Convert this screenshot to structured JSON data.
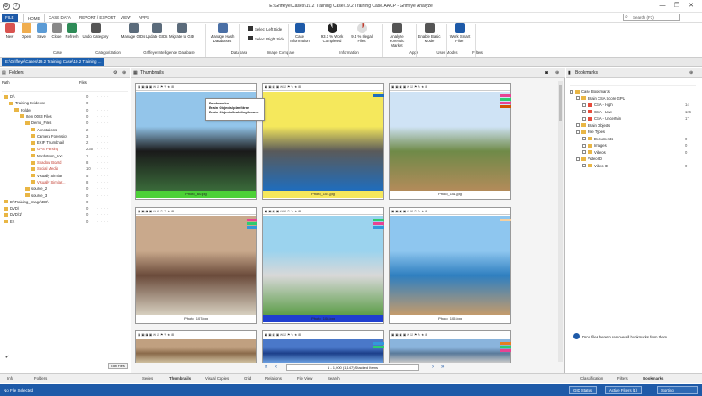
{
  "window": {
    "title": "E:\\Griffeye\\Cases\\19.2 Training Case\\19.2 Training Case.AACP - Griffeye Analyze",
    "quick_access": [
      "⚙",
      "?"
    ],
    "controls": [
      "—",
      "❐",
      "✕"
    ]
  },
  "tabs": [
    "FILE",
    "HOME",
    "CASE DATA",
    "REPORT / EXPORT",
    "VIEW",
    "APPS"
  ],
  "search": {
    "placeholder": "Search (F3)"
  },
  "ribbon": {
    "buttons": [
      {
        "label": "New",
        "color": "#d9534f"
      },
      {
        "label": "Open",
        "color": "#f0ad4e"
      },
      {
        "label": "Save",
        "color": "#5b9bd5"
      },
      {
        "label": "Close",
        "color": "#888888"
      },
      {
        "label": "Refresh",
        "color": "#2e8b57"
      },
      {
        "label": "Undo Category",
        "color": "#555555"
      },
      {
        "label": "Manage GIDs",
        "color": "#5b6b7b"
      },
      {
        "label": "Update GIDs",
        "color": "#5b6b7b"
      },
      {
        "label": "Migrate to GID",
        "color": "#5b6b7b"
      },
      {
        "label": "Manage Hash Databases",
        "color": "#4a6fa5"
      },
      {
        "label": "Select Left Side",
        "color": "#333333"
      },
      {
        "label": "Select Right Side",
        "color": "#333333"
      },
      {
        "label": "Case Information",
        "color": "#1e5aa8"
      },
      {
        "label": "93.1 % Work Completed",
        "color": "#222222"
      },
      {
        "label": "9.4 % Illegal Files",
        "color": "#c0392b"
      },
      {
        "label": "Analyze Forensic Market",
        "color": "#555555"
      },
      {
        "label": "Enable Basic Mode",
        "color": "#555555"
      },
      {
        "label": "Work Smart Filter",
        "color": "#1e5aa8"
      }
    ],
    "groups": [
      "Case",
      "Categorization",
      "Griffeye Intelligence Database",
      "Database",
      "Image Compare",
      "Information",
      "Apps",
      "User Modes",
      "Filters"
    ]
  },
  "path_tab": "E:\\Griffeye\\Cases\\19.2 Training Case\\19.2 Training ...",
  "folders": {
    "title": "Folders",
    "col_path": "Path",
    "col_files": "Files",
    "rows": [
      {
        "name": "D:\\",
        "files": "0",
        "level": 0,
        "color": "#222"
      },
      {
        "name": "Training Evidence",
        "files": "0",
        "level": 1,
        "color": "#222"
      },
      {
        "name": "Folder",
        "files": "0",
        "level": 2,
        "color": "#222"
      },
      {
        "name": "Item 0003 Files",
        "files": "0",
        "level": 3,
        "color": "#222"
      },
      {
        "name": "Demo_Files",
        "files": "0",
        "level": 4,
        "color": "#222"
      },
      {
        "name": "Annotations",
        "files": "2",
        "level": 5,
        "color": "#222"
      },
      {
        "name": "Camera Forensics",
        "files": "3",
        "level": 5,
        "color": "#222"
      },
      {
        "name": "EXIF Thumbnail",
        "files": "2",
        "level": 5,
        "color": "#222"
      },
      {
        "name": "GPS Parsing",
        "files": "235",
        "level": 5,
        "color": "#c0392b"
      },
      {
        "name": "Nordstrom_Loc...",
        "files": "1",
        "level": 5,
        "color": "#222"
      },
      {
        "name": "Shadow Board",
        "files": "8",
        "level": 5,
        "color": "#c0392b"
      },
      {
        "name": "Social Media",
        "files": "10",
        "level": 5,
        "color": "#c0392b"
      },
      {
        "name": "Visually Similar",
        "files": "5",
        "level": 5,
        "color": "#222"
      },
      {
        "name": "Visually Similar...",
        "files": "8",
        "level": 5,
        "color": "#c0392b"
      },
      {
        "name": "source_2",
        "files": "0",
        "level": 4,
        "color": "#222"
      },
      {
        "name": "source_3",
        "files": "0",
        "level": 4,
        "color": "#222"
      },
      {
        "name": "D:\\Training_Image\\ED\\",
        "files": "0",
        "level": 0,
        "color": "#222"
      },
      {
        "name": "DVD\\",
        "files": "0",
        "level": 0,
        "color": "#222"
      },
      {
        "name": "DVD\\1\\",
        "files": "0",
        "level": 0,
        "color": "#222"
      },
      {
        "name": "E:\\",
        "files": "0",
        "level": 0,
        "color": "#222"
      }
    ],
    "edit_button": "Edit Files",
    "bottom_tabs": [
      "Info",
      "Folders"
    ]
  },
  "thumbnails": {
    "title": "Thumbnails",
    "toolbar_text": "▣ ▣ ▣ ▣ ✉ ☑ ⚑ ✎ ★ ⊞",
    "items": [
      {
        "caption": "Photo_60.jpg",
        "bar": "#4cd137",
        "pic": [
          "#93c5ea",
          "#1a1a1a",
          "#3a6b3a"
        ],
        "tags": []
      },
      {
        "caption": "Photo_104.jpg",
        "bar": "#f5e85c",
        "pic": [
          "#f5e85c",
          "#5a5a5a",
          "#1f6dbd"
        ],
        "tags": [
          "#1f6dbd"
        ]
      },
      {
        "caption": "Photo_101.jpg",
        "bar": "#ffffff",
        "pic": [
          "#cfe3f5",
          "#6f8a48",
          "#b38b5a"
        ],
        "tags": [
          "#e84393",
          "#2ecc71",
          "#e84393",
          "#d35400"
        ]
      },
      {
        "caption": "Photo_107.jpg",
        "bar": "#ffffff",
        "pic": [
          "#c9a98c",
          "#6b4b3b",
          "#d7d0c0"
        ],
        "tags": [
          "#e84393",
          "#2ecc71",
          "#3498db"
        ]
      },
      {
        "caption": "Photo_108.jpg",
        "bar": "#1f3fd0",
        "pic": [
          "#9bd3ee",
          "#d8d8d8",
          "#5d9e4a"
        ],
        "tags": [
          "#2ecc71",
          "#e84393",
          "#3498db"
        ]
      },
      {
        "caption": "Photo_105.jpg",
        "bar": "#ffffff",
        "pic": [
          "#8ec6ef",
          "#2f7fc0",
          "#c49b6c"
        ],
        "tags": [
          "#f5d0a0"
        ]
      },
      {
        "caption": "",
        "bar": "#ffffff",
        "pic": [
          "#c0a080",
          "#8a6a4a",
          "#d0c0a0"
        ],
        "tags": []
      },
      {
        "caption": "",
        "bar": "#ffffff",
        "pic": [
          "#4a78c9",
          "#1c3f8a",
          "#6b9fe0"
        ],
        "tags": [
          "#3498db",
          "#2ecc71"
        ]
      },
      {
        "caption": "",
        "bar": "#ffffff",
        "pic": [
          "#8ab4dc",
          "#5a7a9a",
          "#c9c9c9"
        ],
        "tags": [
          "#e67e22",
          "#2ecc71",
          "#e84393"
        ]
      }
    ],
    "tooltip": {
      "title": "Bookmarks",
      "lines": [
        "Brain Objects\\plant\\tree",
        "Brain Objects\\building\\house"
      ]
    },
    "pager": {
      "text": "1 - 1,000 (1,147) Stacked Items",
      "prev": "«",
      "prev1": "‹",
      "next1": "›",
      "next": "»"
    },
    "bottom_tabs": [
      "Series",
      "Thumbnails",
      "Visual Copies",
      "Grid",
      "Relations",
      "File View",
      "Search"
    ]
  },
  "bookmarks": {
    "title": "Bookmarks",
    "rows": [
      {
        "name": "Case Bookmarks",
        "count": "",
        "level": 0,
        "swatch": ""
      },
      {
        "name": "Brain CSA Score GPU",
        "count": "",
        "level": 1,
        "swatch": ""
      },
      {
        "name": "CSA - High",
        "count": "14",
        "level": 2,
        "swatch": "#e74c3c"
      },
      {
        "name": "CSA - Low",
        "count": "126",
        "level": 2,
        "swatch": "#e74c3c"
      },
      {
        "name": "CSA - Uncertain",
        "count": "17",
        "level": 2,
        "swatch": "#e74c3c"
      },
      {
        "name": "Brain Objects",
        "count": "",
        "level": 1,
        "swatch": ""
      },
      {
        "name": "File Types",
        "count": "",
        "level": 1,
        "swatch": ""
      },
      {
        "name": "Documents",
        "count": "0",
        "level": 2,
        "swatch": ""
      },
      {
        "name": "Images",
        "count": "0",
        "level": 2,
        "swatch": ""
      },
      {
        "name": "Videos",
        "count": "0",
        "level": 2,
        "swatch": ""
      },
      {
        "name": "Video ID",
        "count": "",
        "level": 1,
        "swatch": ""
      },
      {
        "name": "Video ID",
        "count": "0",
        "level": 2,
        "swatch": ""
      }
    ],
    "drop_hint": "Drop files here to remove all bookmarks from them",
    "bottom_tabs": [
      "Classification",
      "Filters",
      "Bookmarks"
    ]
  },
  "status": {
    "left": "No File Selected",
    "gid": "GID Status",
    "filters": "Active Filters (1)",
    "sorting": "Sorting"
  }
}
